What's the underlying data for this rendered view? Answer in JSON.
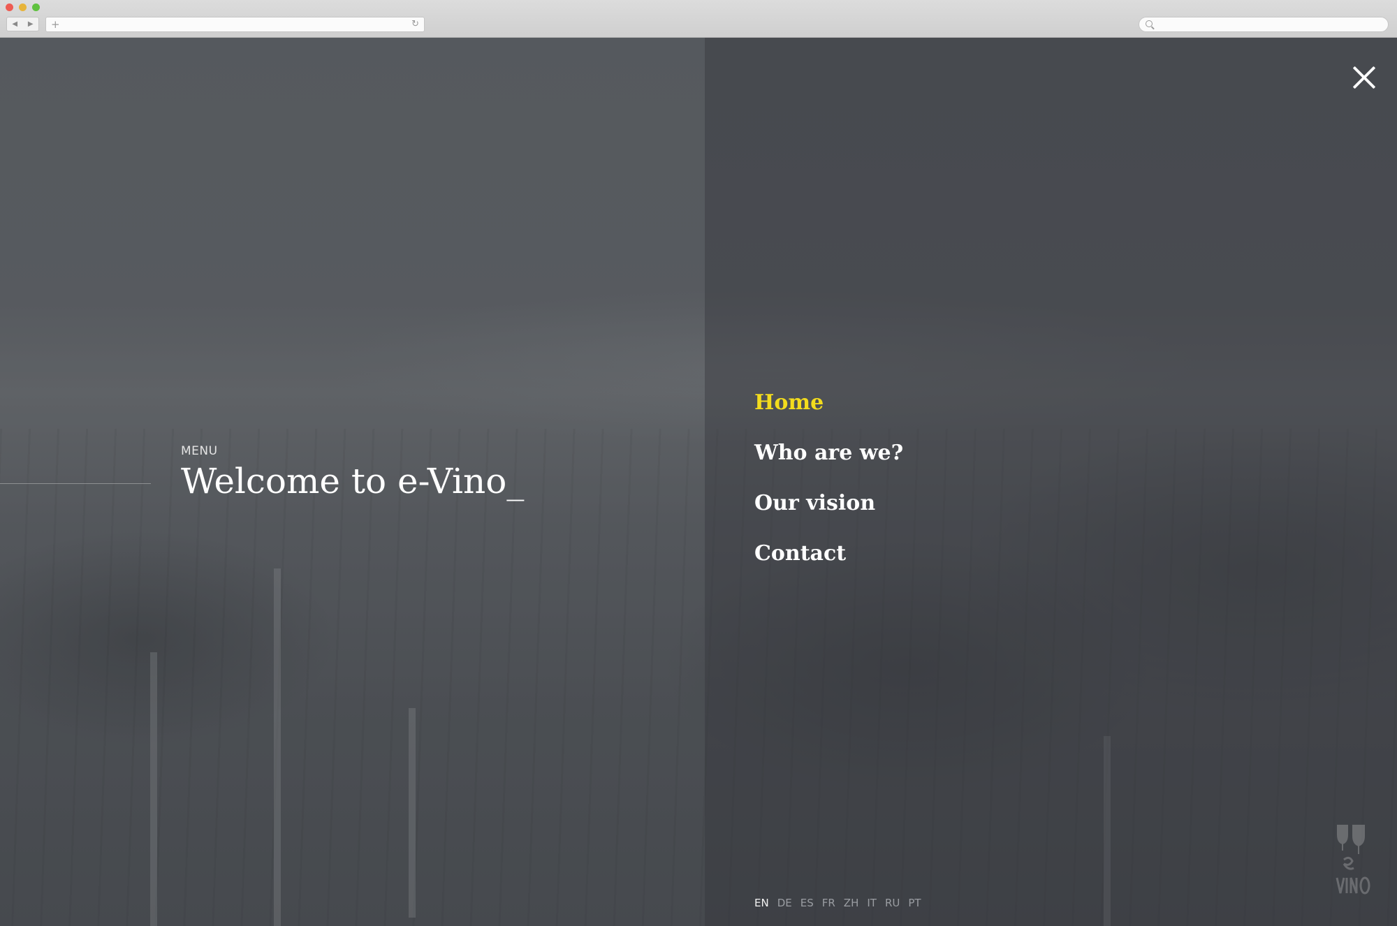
{
  "browser": {
    "back_icon": "back-arrow-icon",
    "forward_icon": "forward-arrow-icon",
    "new_tab_symbol": "+",
    "reload_symbol": "↻"
  },
  "hero": {
    "menu_label": "MENU",
    "title": "Welcome to e-Vino_"
  },
  "nav": {
    "items": [
      {
        "label": "Home",
        "active": true
      },
      {
        "label": "Who are we?",
        "active": false
      },
      {
        "label": "Our vision",
        "active": false
      },
      {
        "label": "Contact",
        "active": false
      }
    ],
    "active_color": "#f3dc1d"
  },
  "languages": [
    "EN",
    "DE",
    "ES",
    "FR",
    "ZH",
    "IT",
    "RU",
    "PT"
  ],
  "active_language": "EN",
  "icons": {
    "close": "close-icon",
    "logo": "e-vino-logo"
  }
}
